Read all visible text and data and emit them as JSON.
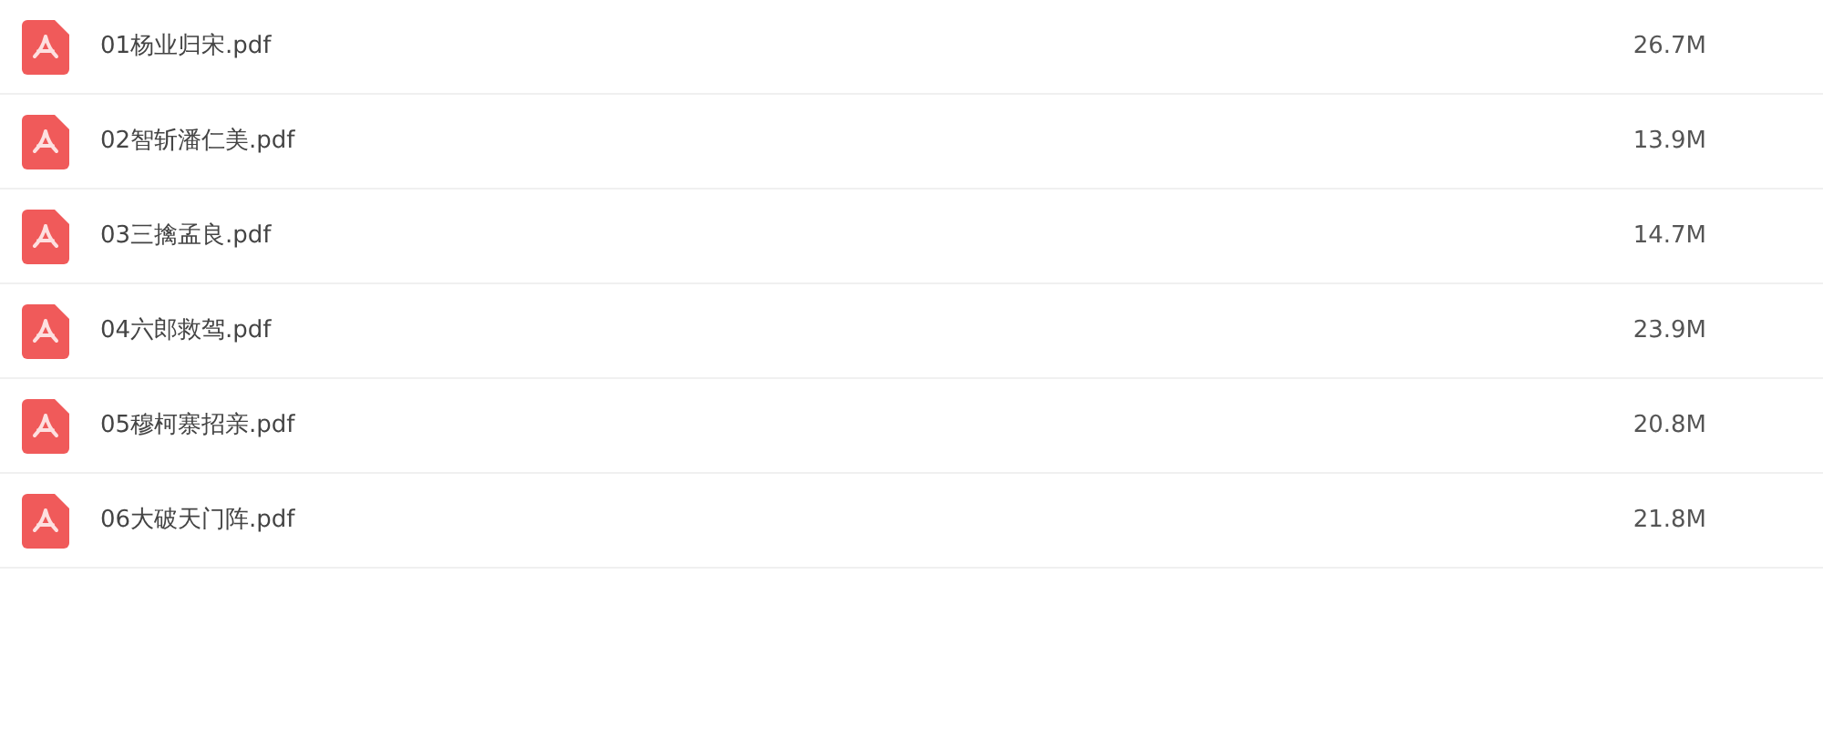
{
  "files": [
    {
      "name": "01杨业归宋.pdf",
      "size": "26.7M"
    },
    {
      "name": "02智斩潘仁美.pdf",
      "size": "13.9M"
    },
    {
      "name": "03三擒孟良.pdf",
      "size": "14.7M"
    },
    {
      "name": "04六郎救驾.pdf",
      "size": "23.9M"
    },
    {
      "name": "05穆柯寨招亲.pdf",
      "size": "20.8M"
    },
    {
      "name": "06大破天门阵.pdf",
      "size": "21.8M"
    }
  ]
}
